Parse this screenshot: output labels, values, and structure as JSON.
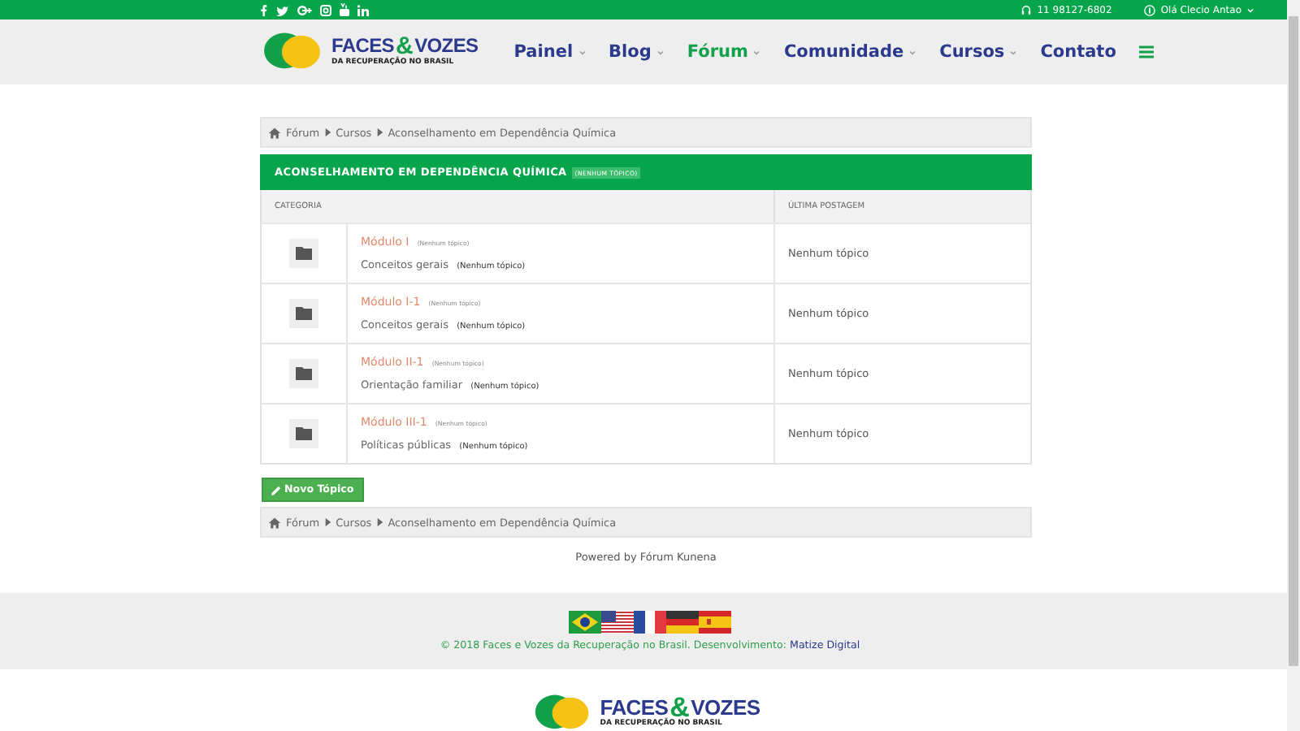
{
  "top_bar": {
    "social": [
      {
        "kind": "facebook"
      },
      {
        "kind": "twitter"
      },
      {
        "kind": "gplus"
      },
      {
        "kind": "instagram"
      },
      {
        "kind": "youtube"
      },
      {
        "kind": "linkedin"
      }
    ],
    "phone": "11 98127-6802",
    "user": "Olá Clecio Antao"
  },
  "header": {
    "logo_title": "FACES",
    "logo_amp": "&",
    "logo_title2": "VOZES",
    "logo_subtitle": "DA RECUPERAÇÃO NO BRASIL",
    "nav": [
      {
        "label": "Painel",
        "dropdown": true,
        "selected": false
      },
      {
        "label": "Blog",
        "dropdown": true,
        "selected": false
      },
      {
        "label": "Fórum",
        "dropdown": true,
        "selected": true
      },
      {
        "label": "Comunidade",
        "dropdown": true,
        "selected": false
      },
      {
        "label": "Cursos",
        "dropdown": true,
        "selected": false
      },
      {
        "label": "Contato",
        "dropdown": false,
        "selected": false
      }
    ]
  },
  "breadcrumb_top": [
    "Fórum",
    "Cursos",
    "Aconselhamento em Dependência Química"
  ],
  "section": {
    "title": "ACONSELHAMENTO EM DEPENDÊNCIA QUÍMICA",
    "badge": "(NENHUM TÓPICO)",
    "columns": [
      "CATEGORIA",
      "ÚLTIMA POSTAGEM"
    ],
    "rows": [
      {
        "name": "Módulo I",
        "name_note": "(Nenhum tópico)",
        "sub": "Conceitos gerais",
        "sub_note": "(Nenhum tópico)",
        "last": "Nenhum tópico"
      },
      {
        "name": "Módulo I-1",
        "name_note": "(Nenhum tópico)",
        "sub": "Conceitos gerais",
        "sub_note": "(Nenhum tópico)",
        "last": "Nenhum tópico"
      },
      {
        "name": "Módulo II-1",
        "name_note": "(Nenhum tópico)",
        "sub": "Orientação familiar",
        "sub_note": "(Nenhum tópico)",
        "last": "Nenhum tópico"
      },
      {
        "name": "Módulo III-1",
        "name_note": "(Nenhum tópico)",
        "sub": "Políticas públicas",
        "sub_note": "(Nenhum tópico)",
        "last": "Nenhum tópico"
      }
    ]
  },
  "new_topic_button": "Novo Tópico",
  "breadcrumb_bottom": [
    "Fórum",
    "Cursos",
    "Aconselhamento em Dependência Química"
  ],
  "powered_by": "Powered by Fórum Kunena",
  "footer": {
    "flags": [
      {
        "kind": "br"
      },
      {
        "kind": "us"
      },
      {
        "kind": "fr"
      },
      {
        "kind": "de"
      },
      {
        "kind": "es"
      }
    ],
    "copyright": "© 2018 Faces e Vozes da Recuperação no Brasil. Desenvolvimento:",
    "developer": "Matize Digital"
  },
  "bottom_logo": {
    "title": "FACES",
    "amp": "&",
    "title2": "VOZES",
    "subtitle": "DA RECUPERAÇÃO NO BRASIL"
  }
}
